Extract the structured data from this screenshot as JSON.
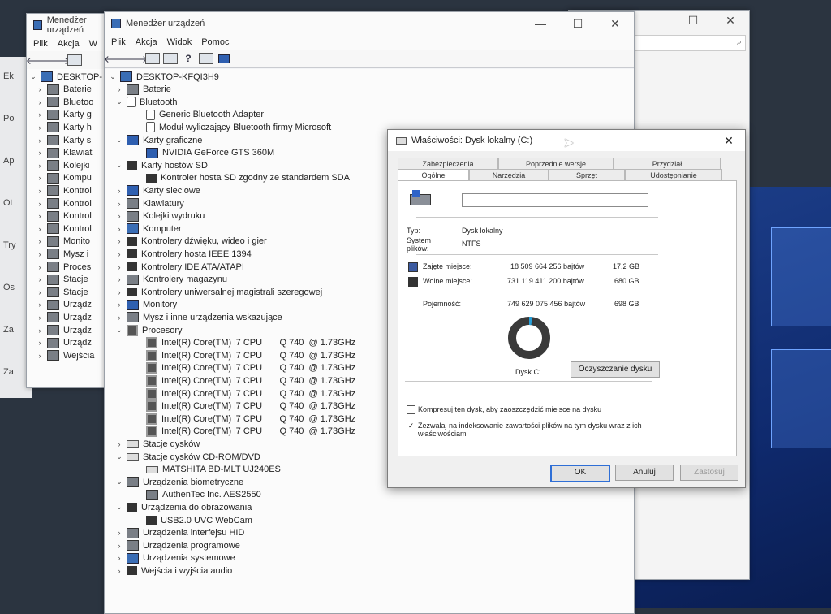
{
  "back_window": {
    "title": "Menedżer urządzeń",
    "menu": [
      "Plik",
      "Akcja",
      "W"
    ],
    "root": "DESKTOP-",
    "items": [
      "Baterie",
      "Bluetoo",
      "Karty g",
      "Karty h",
      "Karty s",
      "Klawiat",
      "Kolejki",
      "Kompu",
      "Kontrol",
      "Kontrol",
      "Kontrol",
      "Kontrol",
      "Monito",
      "Mysz i",
      "Proces",
      "Stacje",
      "Stacje",
      "Urządz",
      "Urządz",
      "Urządz",
      "Urządz",
      "Wejścia"
    ]
  },
  "left_edge_labels": [
    "Ek",
    "Po",
    "Ap",
    "Ot",
    "Try",
    "Os",
    "Za",
    "Za"
  ],
  "main_window": {
    "title": "Menedżer urządzeń",
    "menu": [
      "Plik",
      "Akcja",
      "Widok",
      "Pomoc"
    ],
    "controls": {
      "minimize": "—",
      "maximize": "☐",
      "close": "✕"
    },
    "root": "DESKTOP-KFQI3H9",
    "tree": [
      {
        "label": "Baterie",
        "level": 1,
        "arrow": "›",
        "icon": "gray"
      },
      {
        "label": "Bluetooth",
        "level": 1,
        "arrow": "⌄",
        "icon": "bt"
      },
      {
        "label": "Generic Bluetooth Adapter",
        "level": 2,
        "arrow": "",
        "icon": "bt"
      },
      {
        "label": "Moduł wyliczający Bluetooth firmy Microsoft",
        "level": 2,
        "arrow": "",
        "icon": "bt"
      },
      {
        "label": "Karty graficzne",
        "level": 1,
        "arrow": "⌄",
        "icon": "disp"
      },
      {
        "label": "NVIDIA GeForce GTS 360M",
        "level": 2,
        "arrow": "",
        "icon": "disp"
      },
      {
        "label": "Karty hostów SD",
        "level": 1,
        "arrow": "⌄",
        "icon": "dark"
      },
      {
        "label": "Kontroler hosta SD zgodny ze standardem SDA",
        "level": 2,
        "arrow": "",
        "icon": "dark"
      },
      {
        "label": "Karty sieciowe",
        "level": 1,
        "arrow": "›",
        "icon": "disp"
      },
      {
        "label": "Klawiatury",
        "level": 1,
        "arrow": "›",
        "icon": "gray"
      },
      {
        "label": "Kolejki wydruku",
        "level": 1,
        "arrow": "›",
        "icon": "gray"
      },
      {
        "label": "Komputer",
        "level": 1,
        "arrow": "›",
        "icon": "pc"
      },
      {
        "label": "Kontrolery dźwięku, wideo i gier",
        "level": 1,
        "arrow": "›",
        "icon": "dark"
      },
      {
        "label": "Kontrolery hosta IEEE 1394",
        "level": 1,
        "arrow": "›",
        "icon": "dark"
      },
      {
        "label": "Kontrolery IDE ATA/ATAPI",
        "level": 1,
        "arrow": "›",
        "icon": "dark"
      },
      {
        "label": "Kontrolery magazynu",
        "level": 1,
        "arrow": "›",
        "icon": "gray"
      },
      {
        "label": "Kontrolery uniwersalnej magistrali szeregowej",
        "level": 1,
        "arrow": "›",
        "icon": "dark"
      },
      {
        "label": "Monitory",
        "level": 1,
        "arrow": "›",
        "icon": "disp"
      },
      {
        "label": "Mysz i inne urządzenia wskazujące",
        "level": 1,
        "arrow": "›",
        "icon": "gray"
      },
      {
        "label": "Procesory",
        "level": 1,
        "arrow": "⌄",
        "icon": "cpu"
      },
      {
        "label": "Intel(R) Core(TM) i7 CPU       Q 740  @ 1.73GHz",
        "level": 2,
        "arrow": "",
        "icon": "cpu"
      },
      {
        "label": "Intel(R) Core(TM) i7 CPU       Q 740  @ 1.73GHz",
        "level": 2,
        "arrow": "",
        "icon": "cpu"
      },
      {
        "label": "Intel(R) Core(TM) i7 CPU       Q 740  @ 1.73GHz",
        "level": 2,
        "arrow": "",
        "icon": "cpu"
      },
      {
        "label": "Intel(R) Core(TM) i7 CPU       Q 740  @ 1.73GHz",
        "level": 2,
        "arrow": "",
        "icon": "cpu"
      },
      {
        "label": "Intel(R) Core(TM) i7 CPU       Q 740  @ 1.73GHz",
        "level": 2,
        "arrow": "",
        "icon": "cpu"
      },
      {
        "label": "Intel(R) Core(TM) i7 CPU       Q 740  @ 1.73GHz",
        "level": 2,
        "arrow": "",
        "icon": "cpu"
      },
      {
        "label": "Intel(R) Core(TM) i7 CPU       Q 740  @ 1.73GHz",
        "level": 2,
        "arrow": "",
        "icon": "cpu"
      },
      {
        "label": "Intel(R) Core(TM) i7 CPU       Q 740  @ 1.73GHz",
        "level": 2,
        "arrow": "",
        "icon": "cpu"
      },
      {
        "label": "Stacje dysków",
        "level": 1,
        "arrow": "›",
        "icon": "drive"
      },
      {
        "label": "Stacje dysków CD-ROM/DVD",
        "level": 1,
        "arrow": "⌄",
        "icon": "drive"
      },
      {
        "label": "MATSHITA BD-MLT UJ240ES",
        "level": 2,
        "arrow": "",
        "icon": "drive"
      },
      {
        "label": "Urządzenia biometryczne",
        "level": 1,
        "arrow": "⌄",
        "icon": "gray"
      },
      {
        "label": "AuthenTec Inc. AES2550",
        "level": 2,
        "arrow": "",
        "icon": "gray"
      },
      {
        "label": "Urządzenia do obrazowania",
        "level": 1,
        "arrow": "⌄",
        "icon": "dark"
      },
      {
        "label": "USB2.0 UVC WebCam",
        "level": 2,
        "arrow": "",
        "icon": "dark"
      },
      {
        "label": "Urządzenia interfejsu HID",
        "level": 1,
        "arrow": "›",
        "icon": "gray"
      },
      {
        "label": "Urządzenia programowe",
        "level": 1,
        "arrow": "›",
        "icon": "gray"
      },
      {
        "label": "Urządzenia systemowe",
        "level": 1,
        "arrow": "›",
        "icon": "pc"
      },
      {
        "label": "Wejścia i wyjścia audio",
        "level": 1,
        "arrow": "›",
        "icon": "dark"
      }
    ]
  },
  "dialog": {
    "title": "Właściwości: Dysk lokalny (C:)",
    "close": "✕",
    "tabs_row1": [
      "Zabezpieczenia",
      "Poprzednie wersje",
      "Przydział"
    ],
    "tabs_row2": [
      "Ogólne",
      "Narzędzia",
      "Sprzęt",
      "Udostępnianie"
    ],
    "name_value": "",
    "type_label": "Typ:",
    "type_value": "Dysk lokalny",
    "fs_label": "System plików:",
    "fs_value": "NTFS",
    "used_label": "Zajęte miejsce:",
    "used_bytes": "18 509 664 256 bajtów",
    "used_gb": "17,2 GB",
    "free_label": "Wolne miejsce:",
    "free_bytes": "731 119 411 200 bajtów",
    "free_gb": "680 GB",
    "capacity_label": "Pojemność:",
    "capacity_bytes": "749 629 075 456 bajtów",
    "capacity_gb": "698 GB",
    "drive_label": "Dysk C:",
    "cleanup_button": "Oczyszczanie dysku",
    "compress_label": "Kompresuj ten dysk, aby zaoszczędzić miejsce na dysku",
    "compress_checked": false,
    "index_label": "Zezwalaj na indeksowanie zawartości plików na tym dysku wraz z ich właściwościami",
    "index_checked": true,
    "ok_button": "OK",
    "cancel_button": "Anuluj",
    "apply_button": "Zastosuj",
    "used_fraction": 0.0247,
    "colors": {
      "used": "#26a0da",
      "free": "#bcbcbc",
      "used_swatch": "#3b5aa0",
      "free_swatch": "#333333"
    }
  }
}
